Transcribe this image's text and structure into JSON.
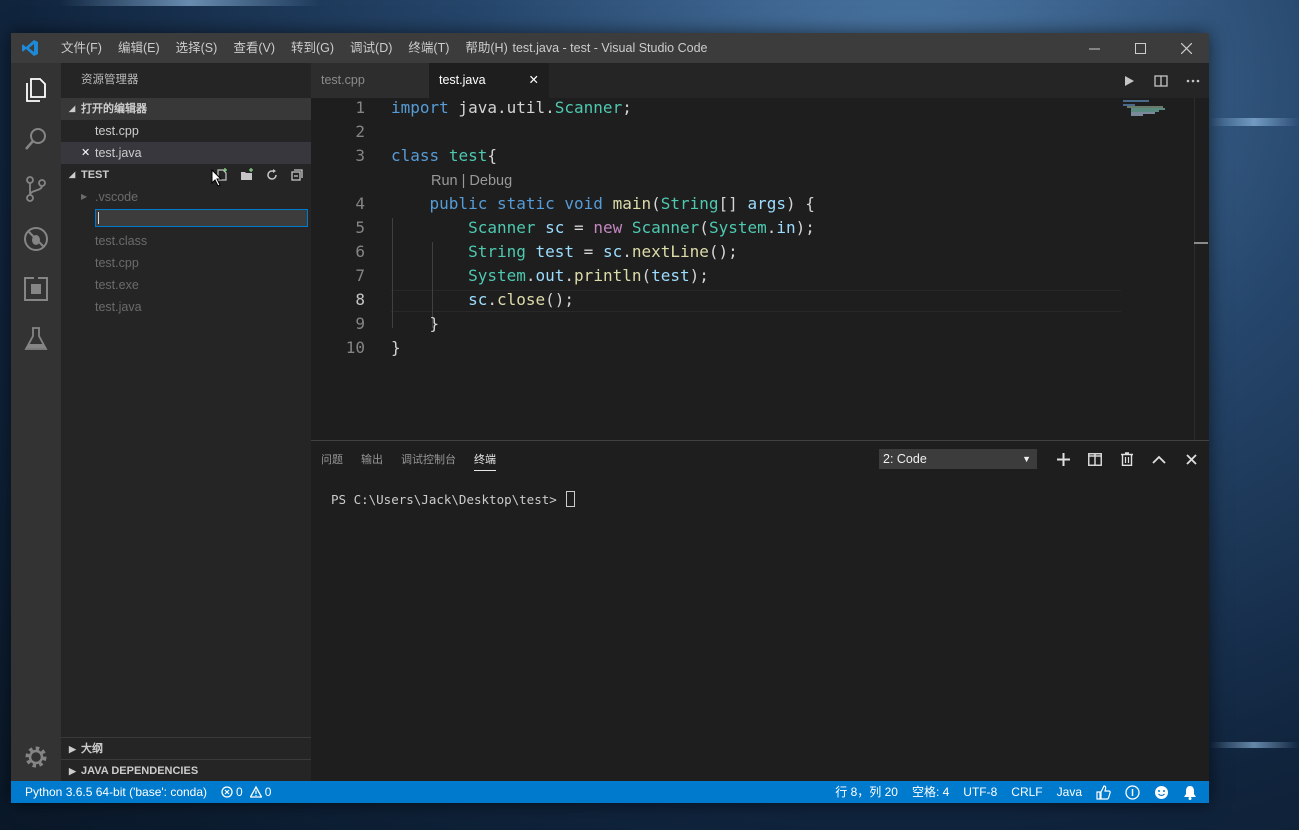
{
  "window": {
    "title": "test.java - test - Visual Studio Code",
    "menu": [
      "文件(F)",
      "编辑(E)",
      "选择(S)",
      "查看(V)",
      "转到(G)",
      "调试(D)",
      "终端(T)",
      "帮助(H)"
    ]
  },
  "activity_bar": [
    "explorer-icon",
    "search-icon",
    "source-control-icon",
    "debug-icon",
    "extensions-icon",
    "test-flask-icon",
    "gear-icon"
  ],
  "sidebar": {
    "title": "资源管理器",
    "open_editors": {
      "label": "打开的编辑器",
      "files": [
        "test.cpp",
        "test.java"
      ],
      "close_glyph": "✕"
    },
    "folder": {
      "label": "TEST",
      "items": [
        ".vscode",
        "test.class",
        "test.cpp",
        "test.exe",
        "test.java"
      ]
    },
    "outline_label": "大纲",
    "java_deps_label": "JAVA DEPENDENCIES"
  },
  "tabs": [
    {
      "label": "test.cpp",
      "active": false
    },
    {
      "label": "test.java",
      "active": true,
      "close": "✕"
    }
  ],
  "editor": {
    "line_numbers": [
      "1",
      "2",
      "3",
      "4",
      "5",
      "6",
      "7",
      "8",
      "9",
      "10"
    ],
    "current_line": "8",
    "codelens": "Run | Debug",
    "lines": [
      "import java.util.Scanner;",
      "",
      "class test{",
      "    public static void main(String[] args) {",
      "        Scanner sc = new Scanner(System.in);",
      "        String test = sc.nextLine();",
      "        System.out.println(test);",
      "        sc.close();",
      "    }",
      "}"
    ]
  },
  "panel": {
    "tabs": [
      "问题",
      "输出",
      "调试控制台",
      "终端"
    ],
    "active_tab": "终端",
    "terminal_select": "2: Code",
    "prompt": "PS C:\\Users\\Jack\\Desktop\\test>"
  },
  "status": {
    "python": "Python 3.6.5 64-bit ('base': conda)",
    "errors": "0",
    "warnings": "0",
    "position": "行 8，列 20",
    "spaces": "空格: 4",
    "encoding": "UTF-8",
    "eol": "CRLF",
    "language": "Java"
  },
  "colors": {
    "accent": "#007acc",
    "keyword": "#569cd6",
    "type": "#4ec9b0",
    "function": "#dcdcaa",
    "variable": "#9cdcfe"
  }
}
